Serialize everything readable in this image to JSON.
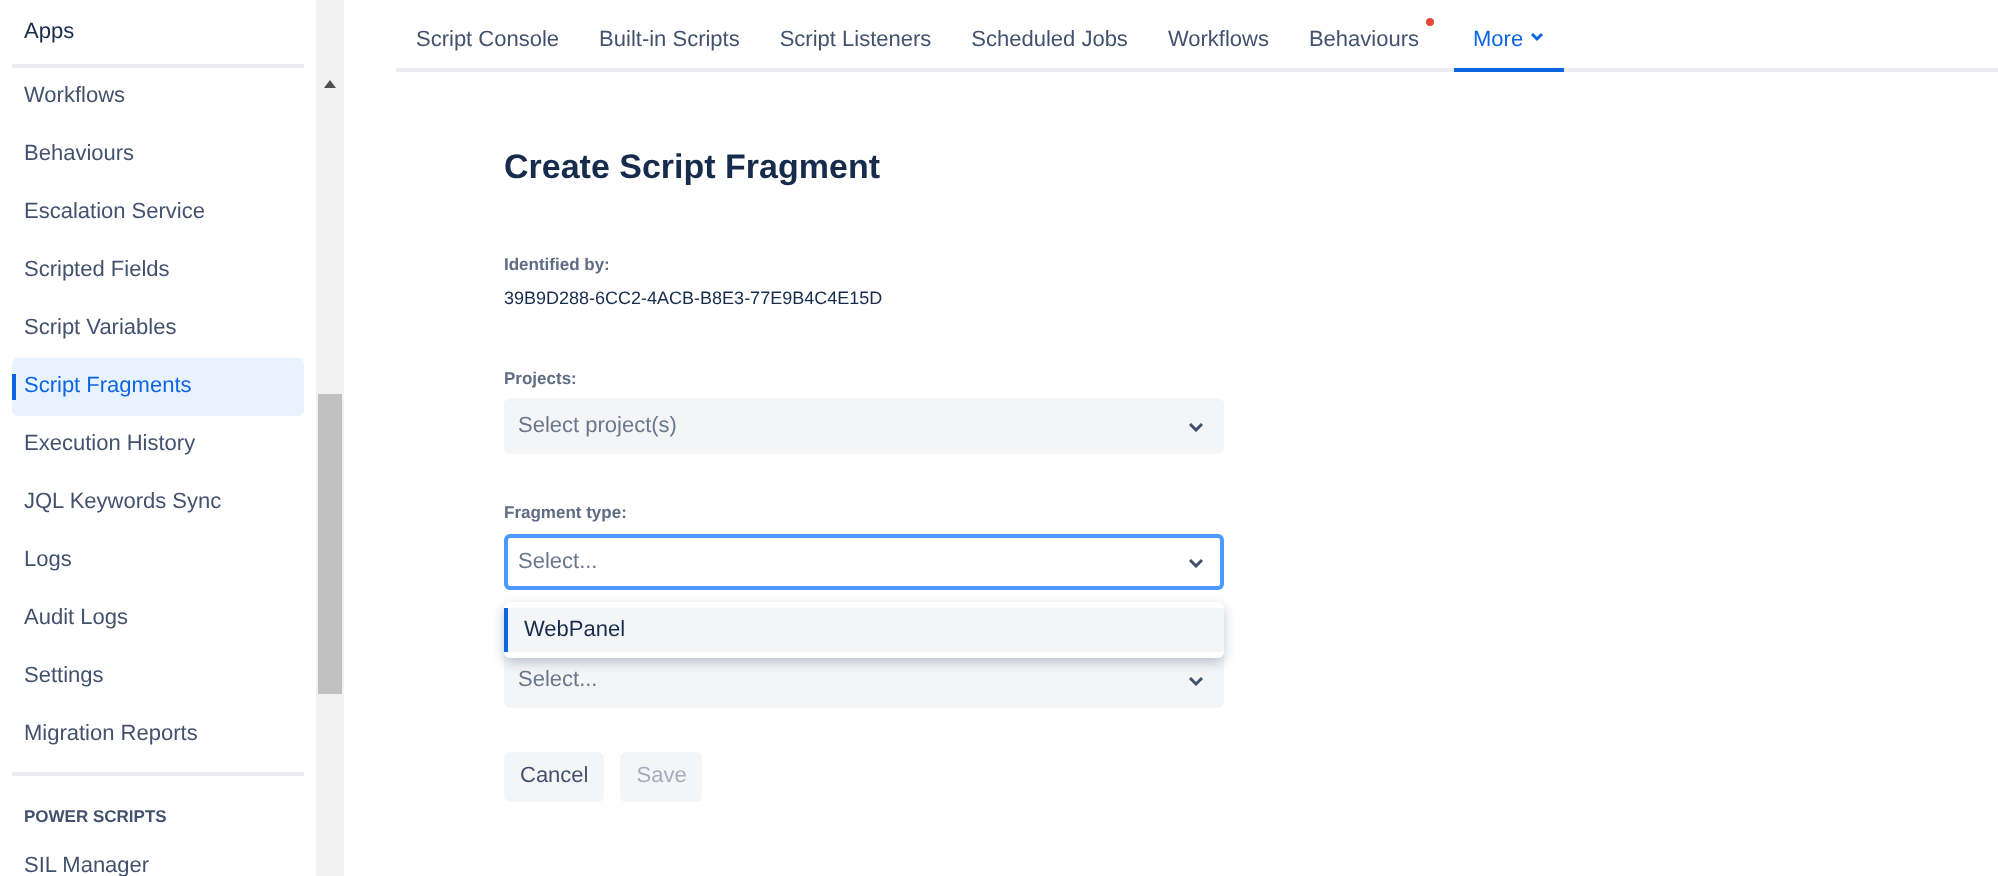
{
  "sidebar": {
    "header": "Apps",
    "items": [
      {
        "label": "Workflows",
        "selected": false
      },
      {
        "label": "Behaviours",
        "selected": false
      },
      {
        "label": "Escalation Service",
        "selected": false
      },
      {
        "label": "Scripted Fields",
        "selected": false
      },
      {
        "label": "Script Variables",
        "selected": false
      },
      {
        "label": "Script Fragments",
        "selected": true
      },
      {
        "label": "Execution History",
        "selected": false
      },
      {
        "label": "JQL Keywords Sync",
        "selected": false
      },
      {
        "label": "Logs",
        "selected": false
      },
      {
        "label": "Audit Logs",
        "selected": false
      },
      {
        "label": "Settings",
        "selected": false
      },
      {
        "label": "Migration Reports",
        "selected": false
      }
    ],
    "section": {
      "title": "POWER SCRIPTS",
      "items": [
        {
          "label": "SIL Manager",
          "selected": false
        }
      ]
    }
  },
  "tabs": [
    {
      "label": "Script Console",
      "selected": false,
      "dot": false,
      "dropdown": false
    },
    {
      "label": "Built-in Scripts",
      "selected": false,
      "dot": false,
      "dropdown": false
    },
    {
      "label": "Script Listeners",
      "selected": false,
      "dot": false,
      "dropdown": false
    },
    {
      "label": "Scheduled Jobs",
      "selected": false,
      "dot": false,
      "dropdown": false
    },
    {
      "label": "Workflows",
      "selected": false,
      "dot": false,
      "dropdown": false
    },
    {
      "label": "Behaviours",
      "selected": false,
      "dot": true,
      "dropdown": false
    },
    {
      "label": "More",
      "selected": true,
      "dot": false,
      "dropdown": true
    }
  ],
  "form": {
    "title": "Create Script Fragment",
    "identified": {
      "label": "Identified by:",
      "value": "39B9D288-6CC2-4ACB-B8E3-77E9B4C4E15D"
    },
    "fields": [
      {
        "label": "Projects:",
        "placeholder": "Select project(s)",
        "focused": false
      },
      {
        "label": "Fragment type:",
        "placeholder": "Select...",
        "focused": true,
        "menu": [
          {
            "label": "WebPanel",
            "selected": true
          }
        ]
      },
      {
        "placeholder": "Select...",
        "focused": false
      }
    ],
    "buttons": [
      {
        "label": "Cancel",
        "disabled": false
      },
      {
        "label": "Save",
        "disabled": true
      }
    ]
  }
}
